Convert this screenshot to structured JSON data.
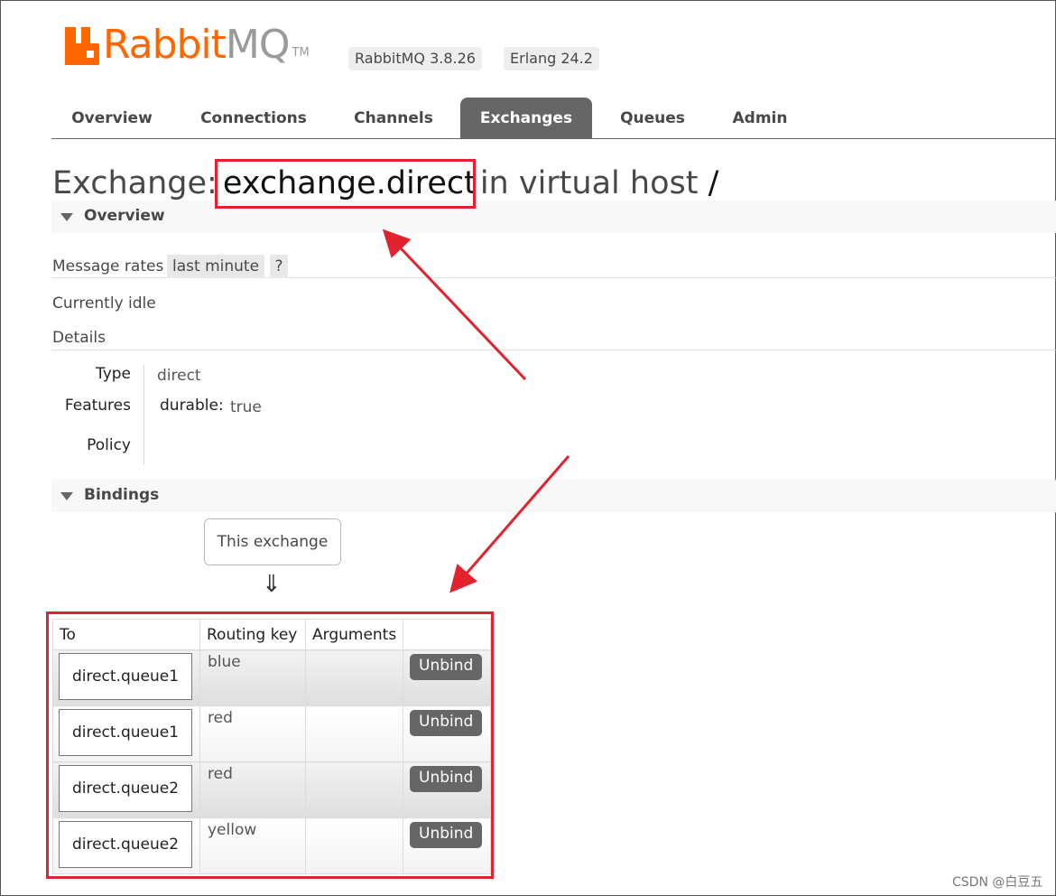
{
  "header": {
    "logo_rabbit": "Rabbit",
    "logo_mq": "MQ",
    "logo_tm": "TM",
    "version_rabbitmq": "RabbitMQ 3.8.26",
    "version_erlang": "Erlang 24.2"
  },
  "tabs": [
    {
      "label": "Overview"
    },
    {
      "label": "Connections"
    },
    {
      "label": "Channels"
    },
    {
      "label": "Exchanges",
      "active": true
    },
    {
      "label": "Queues"
    },
    {
      "label": "Admin"
    }
  ],
  "title": {
    "prefix": "Exchange:",
    "name": "exchange.direct",
    "suffix": "in virtual host",
    "vhost": "/"
  },
  "overview": {
    "section_label": "Overview",
    "message_rates_label": "Message rates",
    "message_rates_option": "last minute",
    "help": "?",
    "status": "Currently idle",
    "details_label": "Details",
    "type_label": "Type",
    "type_value": "direct",
    "features_label": "Features",
    "features_key": "durable:",
    "features_value": "true",
    "policy_label": "Policy"
  },
  "bindings": {
    "section_label": "Bindings",
    "this_exchange": "This exchange",
    "arrow": "⇓",
    "columns": [
      "To",
      "Routing key",
      "Arguments",
      ""
    ],
    "rows": [
      {
        "to": "direct.queue1",
        "routing_key": "blue",
        "arguments": "",
        "action": "Unbind"
      },
      {
        "to": "direct.queue1",
        "routing_key": "red",
        "arguments": "",
        "action": "Unbind"
      },
      {
        "to": "direct.queue2",
        "routing_key": "red",
        "arguments": "",
        "action": "Unbind"
      },
      {
        "to": "direct.queue2",
        "routing_key": "yellow",
        "arguments": "",
        "action": "Unbind"
      }
    ]
  },
  "watermark": "CSDN @白豆五",
  "colors": {
    "brand": "#ff6600",
    "tab_active": "#666666",
    "annotation": "#e2222e"
  }
}
